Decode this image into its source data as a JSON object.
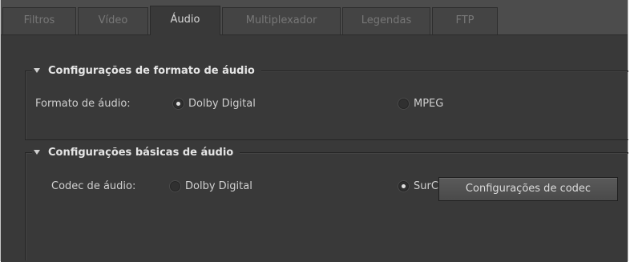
{
  "tabs": [
    {
      "label": "Filtros",
      "active": false
    },
    {
      "label": "Vídeo",
      "active": false
    },
    {
      "label": "Áudio",
      "active": true
    },
    {
      "label": "Multiplexador",
      "active": false
    },
    {
      "label": "Legendas",
      "active": false
    },
    {
      "label": "FTP",
      "active": false
    }
  ],
  "format_group": {
    "title": "Configurações de formato de áudio",
    "field_label": "Formato de áudio:",
    "options": [
      {
        "label": "Dolby Digital",
        "selected": true
      },
      {
        "label": "MPEG",
        "selected": false
      }
    ]
  },
  "basic_group": {
    "title": "Configurações básicas de áudio",
    "field_label": "Codec de áudio:",
    "options": [
      {
        "label": "Dolby Digital",
        "selected": false
      },
      {
        "label": "SurCode",
        "selected": true
      }
    ],
    "codec_button_label": "Configurações de codec"
  },
  "colors": {
    "panel_background": "#393939",
    "tabbar_background": "#4c4c4c",
    "text": "#cfcfcf"
  }
}
